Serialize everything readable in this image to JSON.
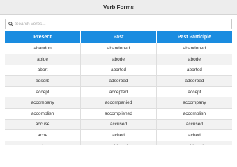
{
  "window": {
    "title": "Verb Forms"
  },
  "search": {
    "placeholder": "Search verbs..."
  },
  "table": {
    "headers": [
      "Present",
      "Past",
      "Past Participle"
    ],
    "rows": [
      [
        "abandon",
        "abandoned",
        "abandoned"
      ],
      [
        "abide",
        "abode",
        "abode"
      ],
      [
        "abort",
        "aborted",
        "aborted"
      ],
      [
        "adsorb",
        "adsorbed",
        "adsorbed"
      ],
      [
        "accept",
        "accepted",
        "accept"
      ],
      [
        "accompany",
        "accompanied",
        "accompany"
      ],
      [
        "accomplish",
        "accomplished",
        "accomplish"
      ],
      [
        "accuse",
        "accused",
        "accused"
      ],
      [
        "ache",
        "ached",
        "ached"
      ],
      [
        "achieve",
        "achieved",
        "achieved"
      ],
      [
        "",
        "",
        ""
      ]
    ]
  },
  "colors": {
    "header_bg": "#1a8ce0",
    "alt_row": "#f2f2f2",
    "titlebar": "#ededed"
  }
}
